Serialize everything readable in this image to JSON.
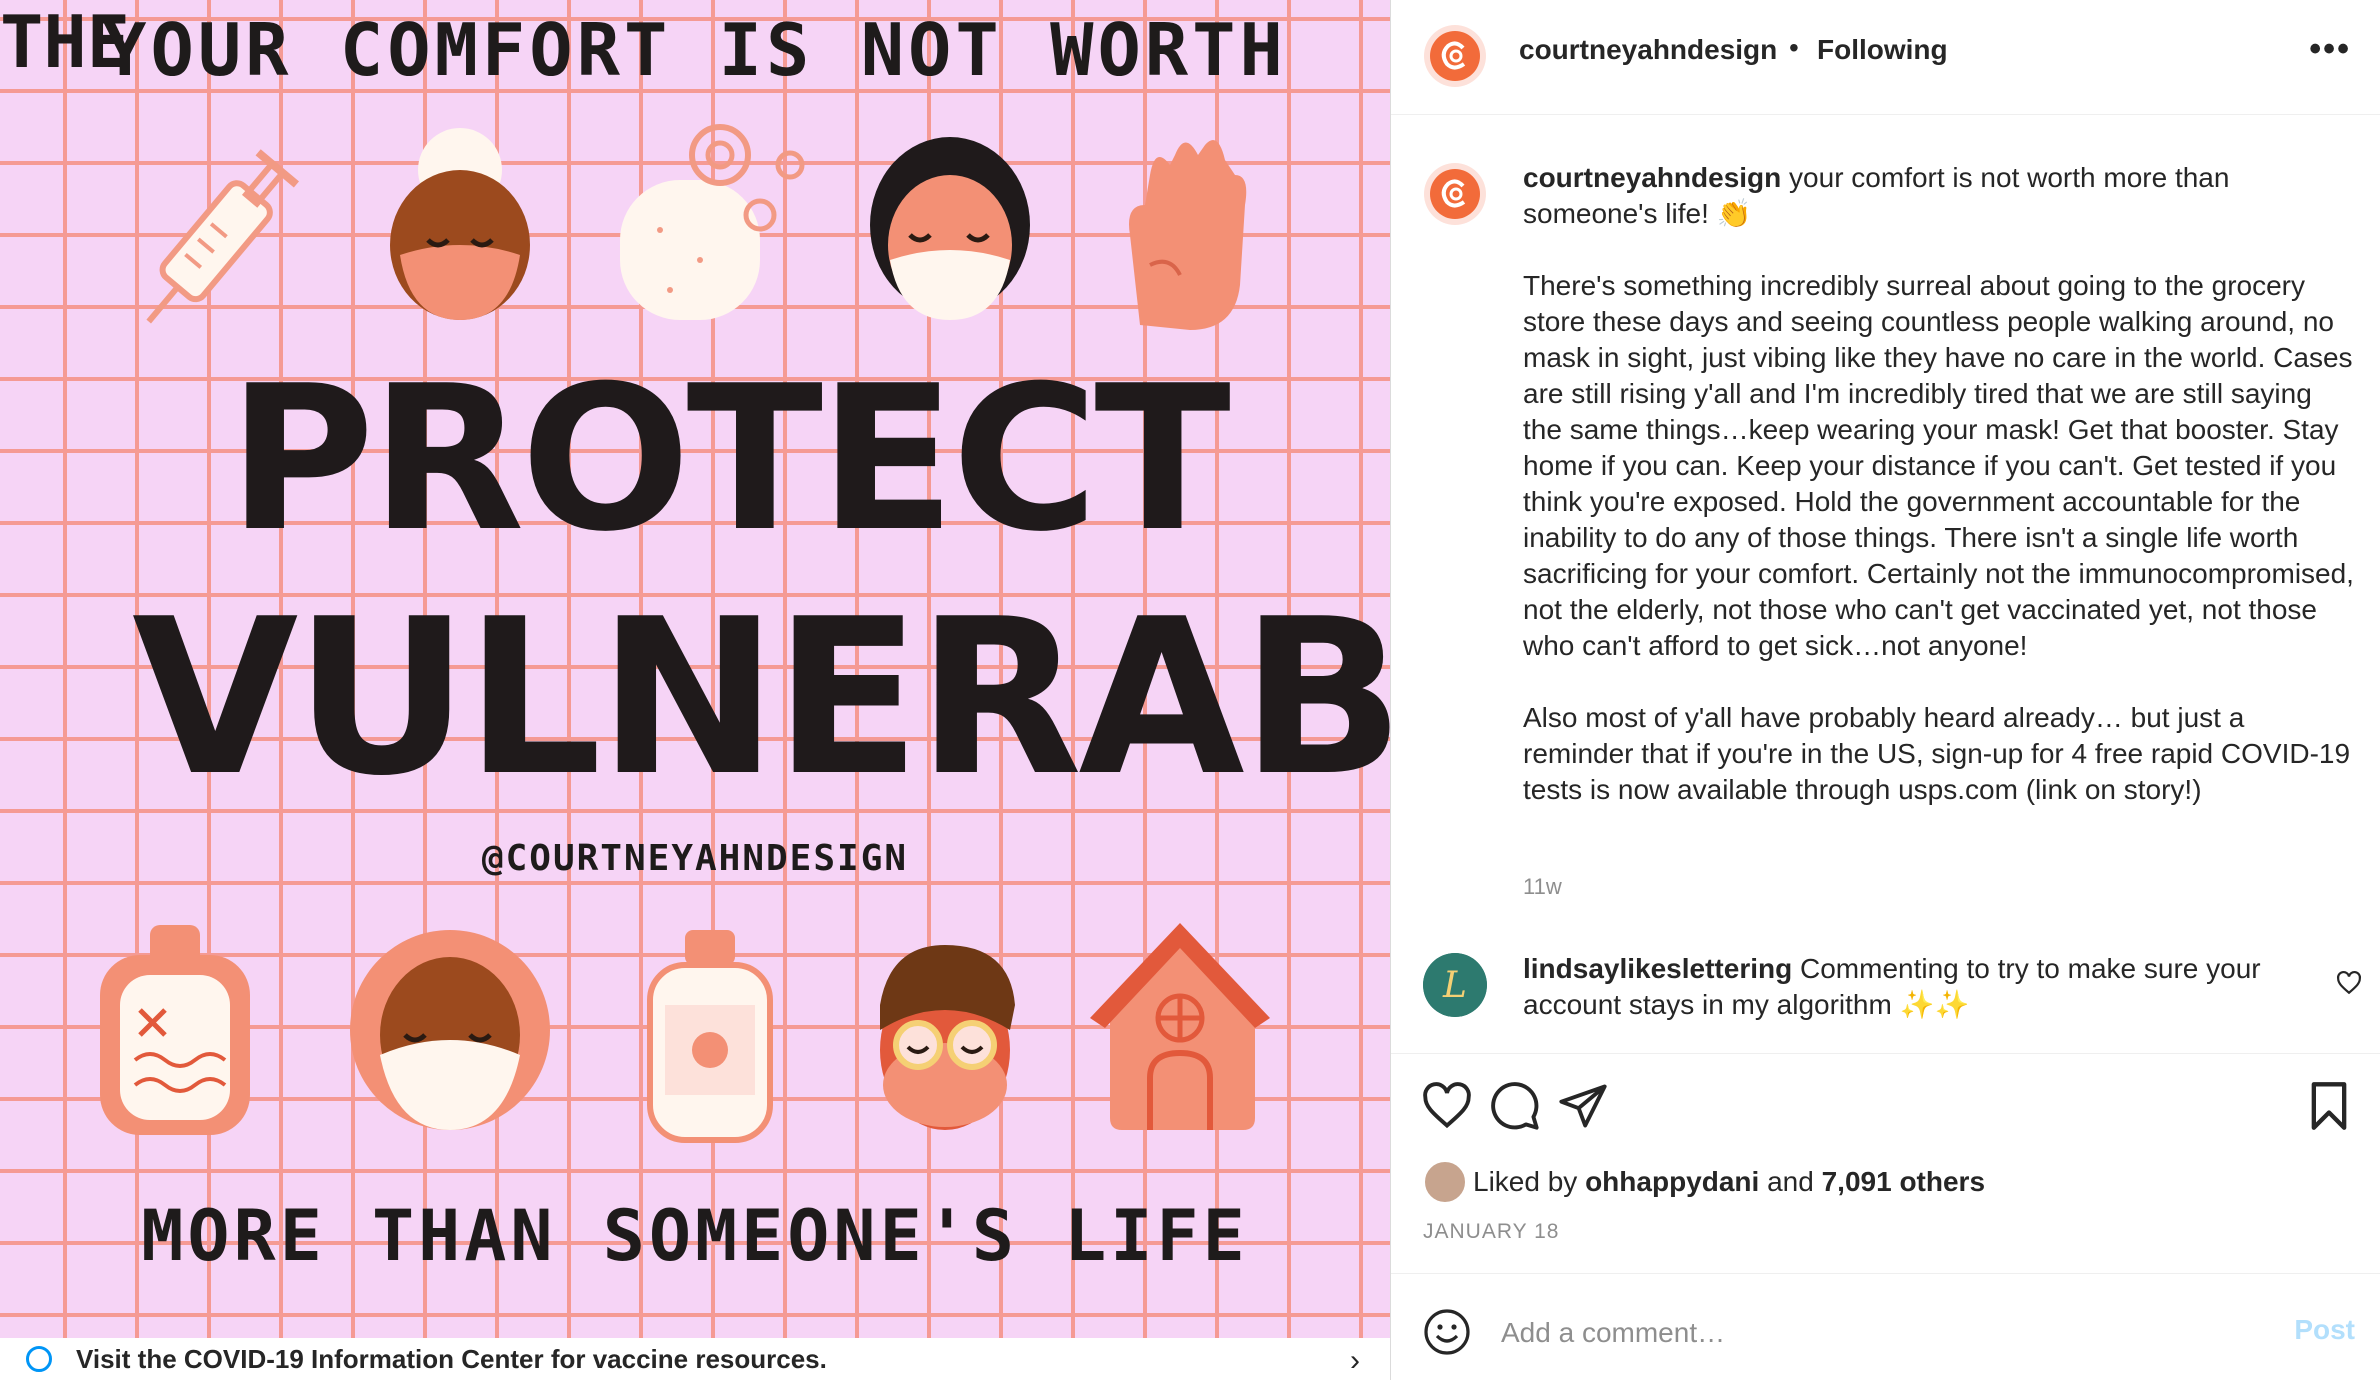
{
  "media": {
    "top_text": "YOUR COMFORT IS NOT WORTH",
    "headline_1": "PROTECT",
    "headline_the": "THE",
    "headline_2": "VULNERABLE",
    "handle": "@COURTNEYAHNDESIGN",
    "bottom_text": "MORE THAN SOMEONE'S LIFE",
    "info_bar": "Visit the COVID-19 Information Center for vaccine resources."
  },
  "header": {
    "username": "courtneyahndesign",
    "separator": "•",
    "follow_status": "Following",
    "more": "•••"
  },
  "caption": {
    "username": "courtneyahndesign",
    "line1": "your comfort is not worth more than someone's life! 👏",
    "para2": "There's something incredibly surreal about going to the grocery store these days and seeing countless people walking around, no mask in sight, just vibing like they have no care in the world. Cases are still rising y'all and I'm incredibly tired that we are still saying the same things…keep wearing your mask! Get that booster. Stay home if you can. Keep your distance if you can't. Get tested if you think you're exposed. Hold the government accountable for the inability to do any of those things. There isn't a single life worth sacrificing for your comfort. Certainly not the immunocompromised, not the elderly, not those who can't get vaccinated yet, not those who can't afford to get sick…not anyone!",
    "para3": "Also most of y'all have probably heard already… but just a reminder that if you're in the US, sign-up for 4 free rapid COVID-19 tests is now available through usps.com (link on story!)",
    "time": "11w"
  },
  "comment": {
    "username": "lindsaylikeslettering",
    "text": "Commenting to try to make sure your account stays in my algorithm ✨✨"
  },
  "likes": {
    "prefix": "Liked by",
    "user": "ohhappydani",
    "joiner": "and",
    "others": "7,091 others"
  },
  "date": "JANUARY 18",
  "composer": {
    "placeholder": "Add a comment…",
    "post_label": "Post"
  },
  "colors": {
    "accent_disabled": "#b2dffc",
    "avatar_orange": "#f26b3a",
    "grid_pink": "#f59a94",
    "bg_pink": "#f6d4f6"
  }
}
